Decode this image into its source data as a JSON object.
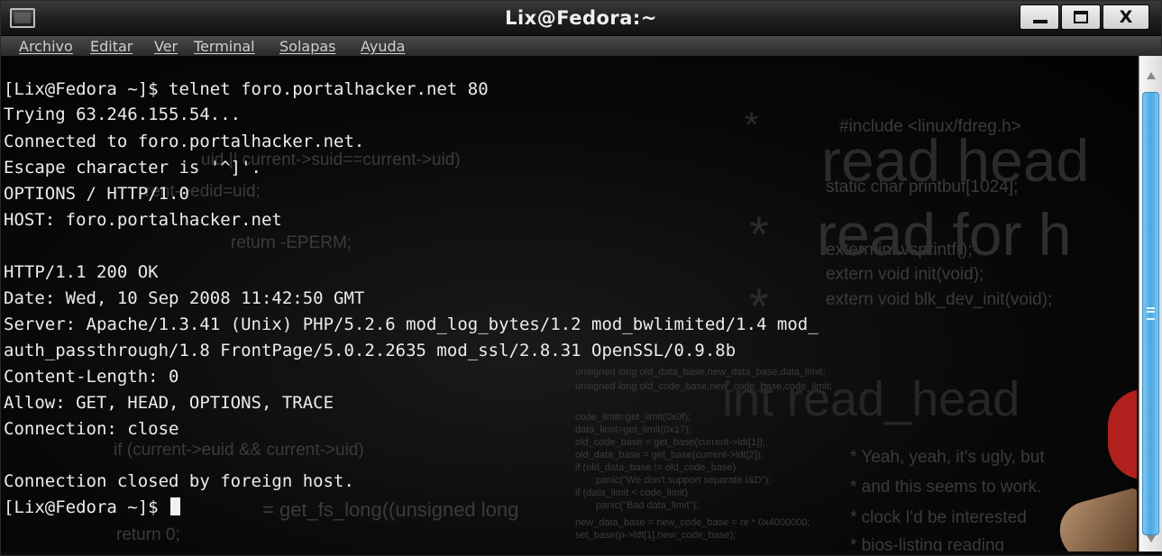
{
  "window": {
    "title": "Lix@Fedora:~"
  },
  "menu": [
    "Archivo",
    "Editar",
    "Ver",
    "Terminal",
    "Solapas",
    "Ayuda"
  ],
  "terminal": {
    "lines": [
      "[Lix@Fedora ~]$ telnet foro.portalhacker.net 80",
      "Trying 63.246.155.54...",
      "Connected to foro.portalhacker.net.",
      "Escape character is '^]'.",
      "OPTIONS / HTTP/1.0",
      "HOST: foro.portalhacker.net",
      "",
      "HTTP/1.1 200 OK",
      "Date: Wed, 10 Sep 2008 11:42:50 GMT",
      "Server: Apache/1.3.41 (Unix) PHP/5.2.6 mod_log_bytes/1.2 mod_bwlimited/1.4 mod_",
      "auth_passthrough/1.8 FrontPage/5.0.2.2635 mod_ssl/2.8.31 OpenSSL/0.9.8b",
      "Content-Length: 0",
      "Allow: GET, HEAD, OPTIONS, TRACE",
      "Connection: close",
      "",
      "Connection closed by foreign host.",
      "[Lix@Fedora ~]$ "
    ]
  },
  "wallpaper": {
    "code_fragments": [
      "uid || current->suid==current->uid)",
      "rent->edid=uid;",
      "return -EPERM;",
      "if (current->euid && current->uid)",
      "= get_fs_long((unsigned long",
      "return 0;",
      "unsigned long old_data_base,new_data_base,data_limit;",
      "unsigned long old_code_base,new_code_base,code_limit;",
      "code_limit=get_limit(0x0f);",
      "data_limit=get_limit(0x17);",
      "old_code_base = get_base(current->ldt[1]);",
      "old_data_base = get_base(current->ldt[2]);",
      "if (old_data_base != old_code_base)",
      "panic(\"We don't support separate I&D\");",
      "if (data_limit < code_limit)",
      "panic(\"Bad data_limit\");",
      "new_data_base = new_code_base = nr * 0x4000000;",
      "set_base(p->ldt[1],new_code_base);",
      "#include <linux/fdreg.h>",
      "static char printbuf[1024];",
      "extern int vsprintf();",
      "extern void init(void);",
      "extern void blk_dev_init(void);",
      "* Yeah, yeah, it's ugly, but",
      "* and this seems to work.",
      "* clock I'd be interested",
      "* bios-listing reading"
    ],
    "big_fragments": [
      "read head",
      "read for h",
      "int read_head"
    ],
    "star_glyph": "*"
  },
  "colors": {
    "text": "#ececec",
    "scroll_thumb": "#4aa8e0",
    "titlebar": "#1f1f1f"
  }
}
